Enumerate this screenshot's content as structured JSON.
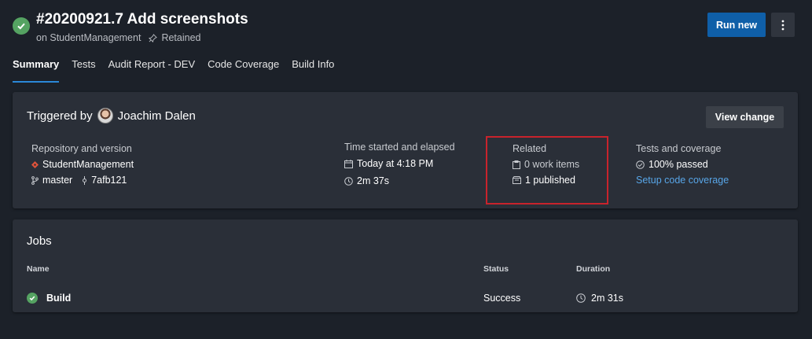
{
  "header": {
    "title": "#20200921.7 Add screenshots",
    "subtitle_repo": "on StudentManagement",
    "subtitle_retained": "Retained",
    "run_new_label": "Run new"
  },
  "tabs": [
    {
      "label": "Summary"
    },
    {
      "label": "Tests"
    },
    {
      "label": "Audit Report - DEV"
    },
    {
      "label": "Code Coverage"
    },
    {
      "label": "Build Info"
    }
  ],
  "summary": {
    "triggered_prefix": "Triggered by",
    "triggered_user": "Joachim Dalen",
    "view_change_label": "View change",
    "repo": {
      "heading": "Repository and version",
      "name": "StudentManagement",
      "branch": "master",
      "commit": "7afb121"
    },
    "time": {
      "heading": "Time started and elapsed",
      "started": "Today at 4:18 PM",
      "elapsed": "2m 37s"
    },
    "related": {
      "heading": "Related",
      "work_items": "0 work items",
      "published": "1 published"
    },
    "tests": {
      "heading": "Tests and coverage",
      "passed": "100% passed",
      "setup_link": "Setup code coverage"
    }
  },
  "jobs": {
    "title": "Jobs",
    "columns": [
      "Name",
      "Status",
      "Duration"
    ],
    "rows": [
      {
        "name": "Build",
        "status": "Success",
        "duration": "2m 31s"
      }
    ]
  },
  "colors": {
    "success": "#55a362",
    "primary_button": "#0f5fa8",
    "link": "#58a6e8",
    "highlight": "#c8232c"
  }
}
